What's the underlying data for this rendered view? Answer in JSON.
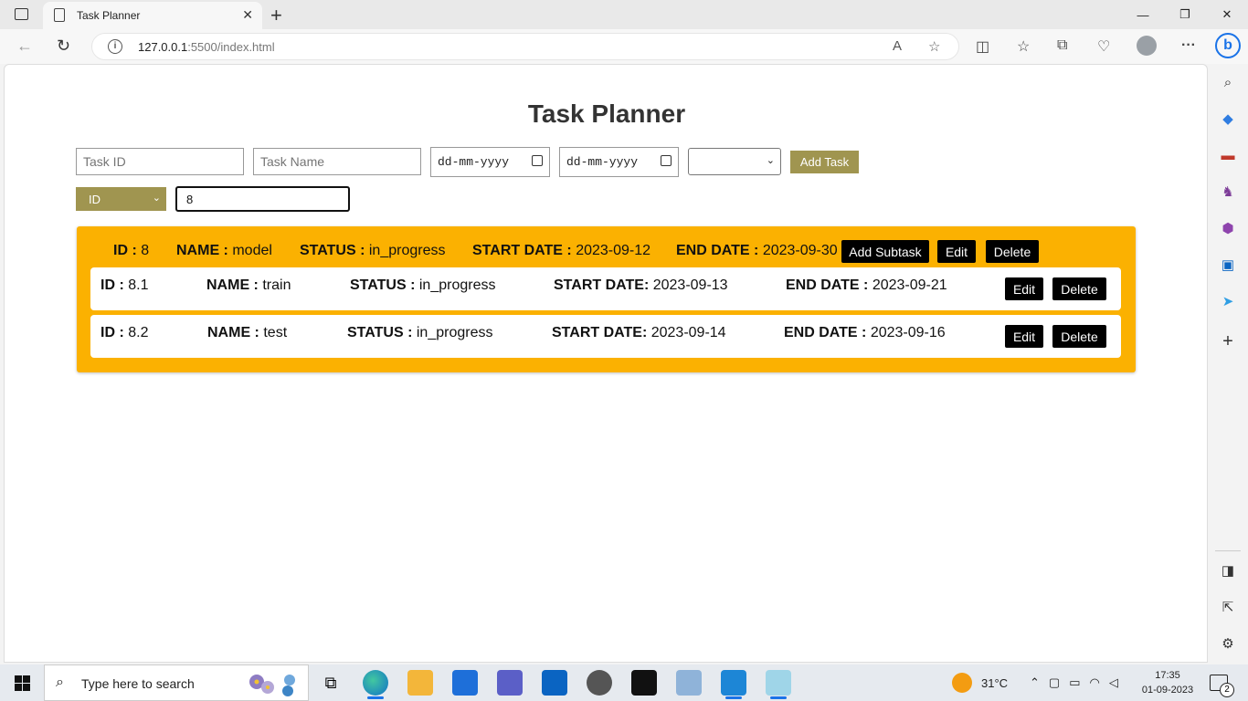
{
  "browser": {
    "tab_title": "Task Planner",
    "url_host": "127.0.0.1",
    "url_rest": ":5500/index.html"
  },
  "page": {
    "title": "Task Planner",
    "form": {
      "task_id_placeholder": "Task ID",
      "task_name_placeholder": "Task Name",
      "start_date_placeholder": "dd-mm-yyyy",
      "end_date_placeholder": "dd-mm-yyyy",
      "status_value": "",
      "add_button": "Add Task"
    },
    "filter": {
      "field": "ID",
      "value": "8"
    },
    "task": {
      "labels": {
        "id": "ID :",
        "name": "NAME :",
        "status": "STATUS :",
        "start": "START DATE :",
        "end": "END DATE :"
      },
      "id": "8",
      "name": "model",
      "status": "in_progress",
      "start_date": "2023-09-12",
      "end_date": "2023-09-30",
      "buttons": {
        "add_subtask": "Add Subtask",
        "edit": "Edit",
        "delete": "Delete"
      },
      "subtasks": [
        {
          "labels": {
            "id": "ID :",
            "name": "NAME :",
            "status": "STATUS :",
            "start": "START DATE:",
            "end": "END DATE :"
          },
          "id": "8.1",
          "name": "train",
          "status": "in_progress",
          "start_date": "2023-09-13",
          "end_date": "2023-09-21",
          "buttons": {
            "edit": "Edit",
            "delete": "Delete"
          }
        },
        {
          "labels": {
            "id": "ID :",
            "name": "NAME :",
            "status": "STATUS :",
            "start": "START DATE:",
            "end": "END DATE :"
          },
          "id": "8.2",
          "name": "test",
          "status": "in_progress",
          "start_date": "2023-09-14",
          "end_date": "2023-09-16",
          "buttons": {
            "edit": "Edit",
            "delete": "Delete"
          }
        }
      ]
    }
  },
  "taskbar": {
    "search_placeholder": "Type here to search",
    "temperature": "31°C",
    "time": "17:35",
    "date": "01-09-2023",
    "notification_count": "2"
  },
  "colors": {
    "accent_olive": "#a09550",
    "card_yellow": "#fbb101",
    "button_black": "#000000"
  }
}
